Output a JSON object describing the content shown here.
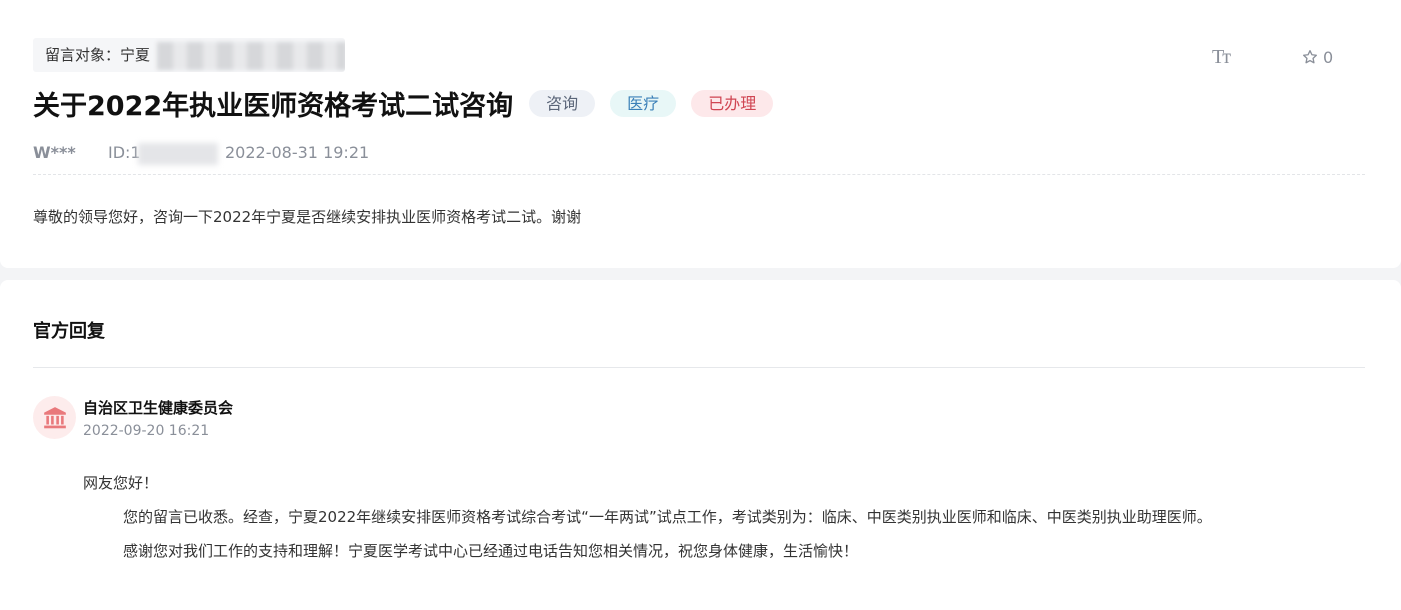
{
  "message": {
    "target_label": "留言对象：宁夏",
    "title": "关于2022年执业医师资格考试二试咨询",
    "tags": [
      "咨询",
      "医疗",
      "已办理"
    ],
    "user": "W***",
    "id_label": "ID:1",
    "datetime": "2022-08-31 19:21",
    "content": "尊敬的领导您好，咨询一下2022年宁夏是否继续安排执业医师资格考试二试。谢谢",
    "font_size_icon": "Tт",
    "star_count": "0"
  },
  "reply": {
    "heading": "官方回复",
    "org": "自治区卫生健康委员会",
    "datetime": "2022-09-20 16:21",
    "greeting": "网友您好！",
    "paragraph1": "您的留言已收悉。经查，宁夏2022年继续安排医师资格考试综合考试“一年两试”试点工作，考试类别为：临床、中医类别执业医师和临床、中医类别执业助理医师。",
    "paragraph2": "感谢您对我们工作的支持和理解！宁夏医学考试中心已经通过电话告知您相关情况，祝您身体健康，生活愉快！"
  },
  "icons": {
    "font_size": "font-size-icon",
    "star": "star-icon",
    "avatar": "government-building-icon"
  },
  "colors": {
    "tag_consult": "#5a6578",
    "tag_medical": "#3a80b8",
    "tag_done": "#d04552",
    "avatar_bg": "#fdecec"
  }
}
